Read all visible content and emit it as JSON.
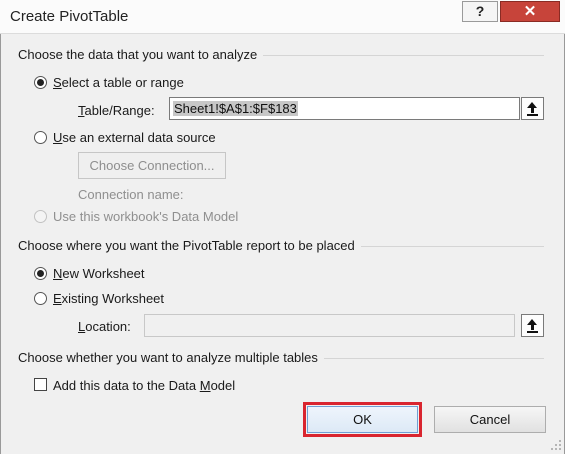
{
  "dialog": {
    "title": "Create PivotTable",
    "help_glyph": "?",
    "close_glyph": "✕"
  },
  "source": {
    "heading": "Choose the data that you want to analyze",
    "option_table_range": {
      "label_prefix": "",
      "label_key": "S",
      "label_rest": "elect a table or range",
      "checked": true
    },
    "table_range": {
      "label_prefix": "",
      "label_key": "T",
      "label_rest": "able/Range:",
      "value": "Sheet1!$A$1:$F$183"
    },
    "option_external": {
      "label_prefix": "",
      "label_key": "U",
      "label_rest": "se an external data source",
      "checked": false
    },
    "choose_connection_label": "Choose Connection...",
    "connection_name_label": "Connection name:",
    "option_data_model": {
      "label_prefix": "Use this workbook's Data ",
      "label_key": "",
      "label_rest": "Model",
      "checked": false,
      "disabled": true
    }
  },
  "placement": {
    "heading": "Choose where you want the PivotTable report to be placed",
    "option_new": {
      "label_prefix": "",
      "label_key": "N",
      "label_rest": "ew Worksheet",
      "checked": true
    },
    "option_existing": {
      "label_prefix": "",
      "label_key": "E",
      "label_rest": "xisting Worksheet",
      "checked": false
    },
    "location": {
      "label_prefix": "",
      "label_key": "L",
      "label_rest": "ocation:",
      "value": ""
    }
  },
  "multiple": {
    "heading": "Choose whether you want to analyze multiple tables",
    "add_to_model": {
      "label_prefix": "Add this data to the Data ",
      "label_key": "M",
      "label_rest": "odel",
      "checked": false
    }
  },
  "buttons": {
    "ok_label": "OK",
    "cancel_label": "Cancel"
  },
  "colors": {
    "ok_highlight": "#d9252f",
    "close_button": "#c7443a",
    "dialog_background": "#f0f0f0"
  }
}
